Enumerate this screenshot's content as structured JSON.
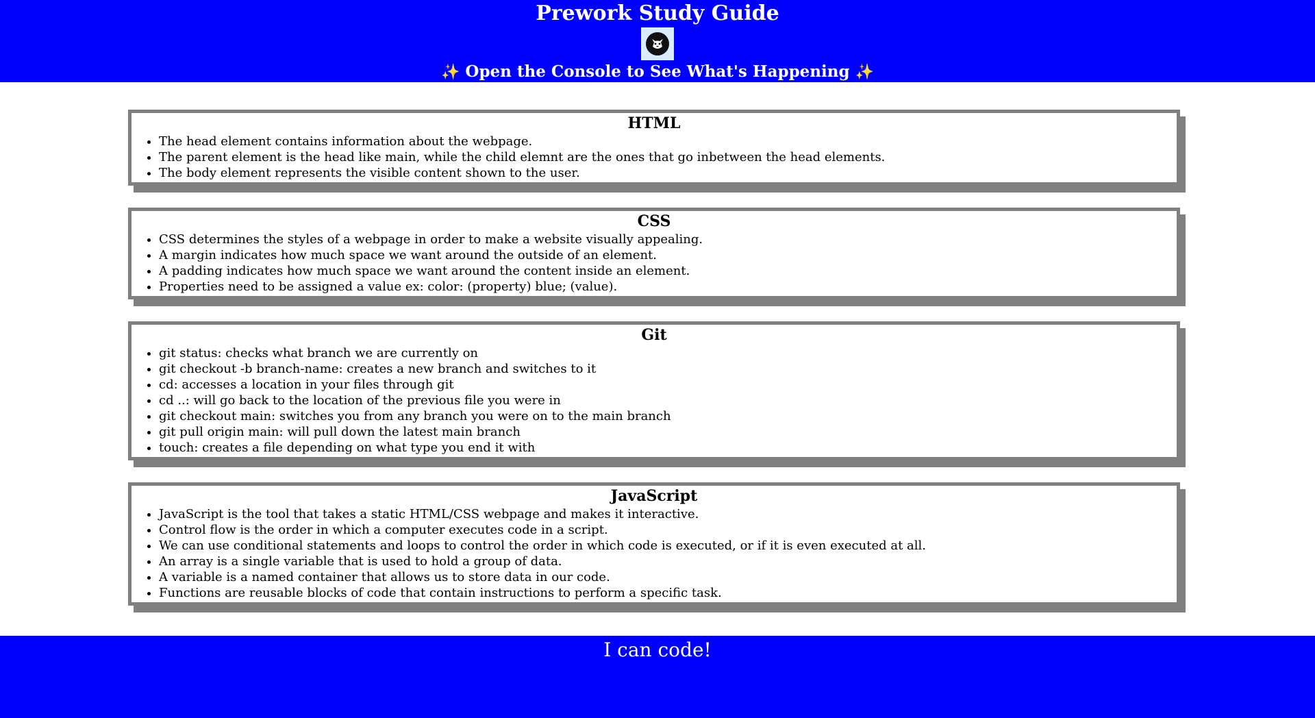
{
  "header": {
    "title": "Prework Study Guide",
    "logo_icon": "cat-icon",
    "subtitle": "Open the Console to See What's Happening",
    "sparkle": "✨"
  },
  "colors": {
    "banner": "#0000ff",
    "card_border": "#808080"
  },
  "sections": [
    {
      "title": "HTML",
      "items": [
        "The head element contains information about the webpage.",
        "The parent element is the head like main, while the child elemnt are the ones that go inbetween the head elements.",
        "The body element represents the visible content shown to the user."
      ]
    },
    {
      "title": "CSS",
      "items": [
        "CSS determines the styles of a webpage in order to make a website visually appealing.",
        "A margin indicates how much space we want around the outside of an element.",
        "A padding indicates how much space we want around the content inside an element.",
        "Properties need to be assigned a value ex: color: (property) blue; (value)."
      ]
    },
    {
      "title": "Git",
      "items": [
        "git status: checks what branch we are currently on",
        "git checkout -b branch-name: creates a new branch and switches to it",
        "cd: accesses a location in your files through git",
        "cd ..: will go back to the location of the previous file you were in",
        "git checkout main: switches you from any branch you were on to the main branch",
        "git pull origin main: will pull down the latest main branch",
        "touch: creates a file depending on what type you end it with"
      ]
    },
    {
      "title": "JavaScript",
      "items": [
        "JavaScript is the tool that takes a static HTML/CSS webpage and makes it interactive.",
        "Control flow is the order in which a computer executes code in a script.",
        "We can use conditional statements and loops to control the order in which code is executed, or if it is even executed at all.",
        "An array is a single variable that is used to hold a group of data.",
        "A variable is a named container that allows us to store data in our code.",
        "Functions are reusable blocks of code that contain instructions to perform a specific task."
      ]
    }
  ],
  "footer": {
    "text": "I can code!"
  }
}
